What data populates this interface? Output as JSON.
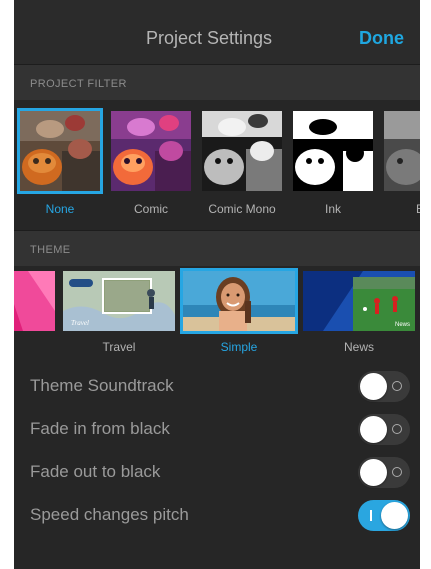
{
  "header": {
    "title": "Project Settings",
    "done_label": "Done"
  },
  "project_filter": {
    "section_label": "PROJECT FILTER",
    "items": [
      {
        "label": "None",
        "selected": true
      },
      {
        "label": "Comic",
        "selected": false
      },
      {
        "label": "Comic Mono",
        "selected": false
      },
      {
        "label": "Ink",
        "selected": false
      },
      {
        "label": "B&",
        "selected": false
      }
    ]
  },
  "theme": {
    "section_label": "THEME",
    "items": [
      {
        "label": "",
        "selected": false
      },
      {
        "label": "Travel",
        "selected": false
      },
      {
        "label": "Simple",
        "selected": true
      },
      {
        "label": "News",
        "selected": false
      }
    ],
    "travel_title_card": "Travel",
    "news_card": "News"
  },
  "settings": [
    {
      "label": "Theme Soundtrack",
      "on": false
    },
    {
      "label": "Fade in from black",
      "on": false
    },
    {
      "label": "Fade out to black",
      "on": false
    },
    {
      "label": "Speed changes pitch",
      "on": true
    }
  ],
  "colors": {
    "accent": "#26a6e3",
    "background": "#262626"
  }
}
